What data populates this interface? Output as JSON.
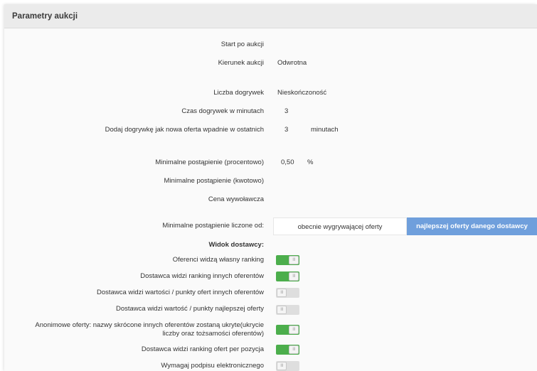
{
  "panel": {
    "title": "Parametry aukcji"
  },
  "fields": {
    "start_label": "Start po aukcji",
    "direction_label": "Kierunek aukcji",
    "direction_value": "Odwrotna",
    "extensions_label": "Liczba dogrywek",
    "extensions_value": "Nieskończoność",
    "ext_time_label": "Czas dogrywek w minutach",
    "ext_time_value": "3",
    "ext_trigger_label": "Dodaj dogrywkę jak nowa oferta wpadnie w ostatnich",
    "ext_trigger_value": "3",
    "ext_trigger_unit": "minutach",
    "min_step_pct_label": "Minimalne postąpienie (procentowo)",
    "min_step_pct_value": "0,50",
    "min_step_pct_unit": "%",
    "min_step_amt_label": "Minimalne postąpienie (kwotowo)",
    "start_price_label": "Cena wywoławcza",
    "min_step_from_label": "Minimalne postąpienie liczone od:",
    "min_step_from_options": [
      "obecnie wygrywającej oferty",
      "najlepszej oferty danego dostawcy"
    ],
    "min_step_from_selected": "najlepszej oferty danego dostawcy"
  },
  "supplier_view": {
    "heading": "Widok dostawcy:",
    "toggles": [
      {
        "label": "Oferenci widzą własny ranking",
        "on": true
      },
      {
        "label": "Dostawca widzi ranking innych oferentów",
        "on": true
      },
      {
        "label": "Dostawca widzi wartości / punkty ofert innych oferentów",
        "on": false
      },
      {
        "label": "Dostawca widzi wartość / punkty najlepszej oferty",
        "on": false
      },
      {
        "label": "Anonimowe oferty: nazwy skrócone innych oferentów zostaną ukryte(ukrycie liczby oraz tożsamości oferentów)",
        "on": true
      },
      {
        "label": "Dostawca widzi ranking ofert per pozycja",
        "on": true
      },
      {
        "label": "Wymagaj podpisu elektronicznego",
        "on": false
      }
    ],
    "knob_glyph": "III"
  }
}
